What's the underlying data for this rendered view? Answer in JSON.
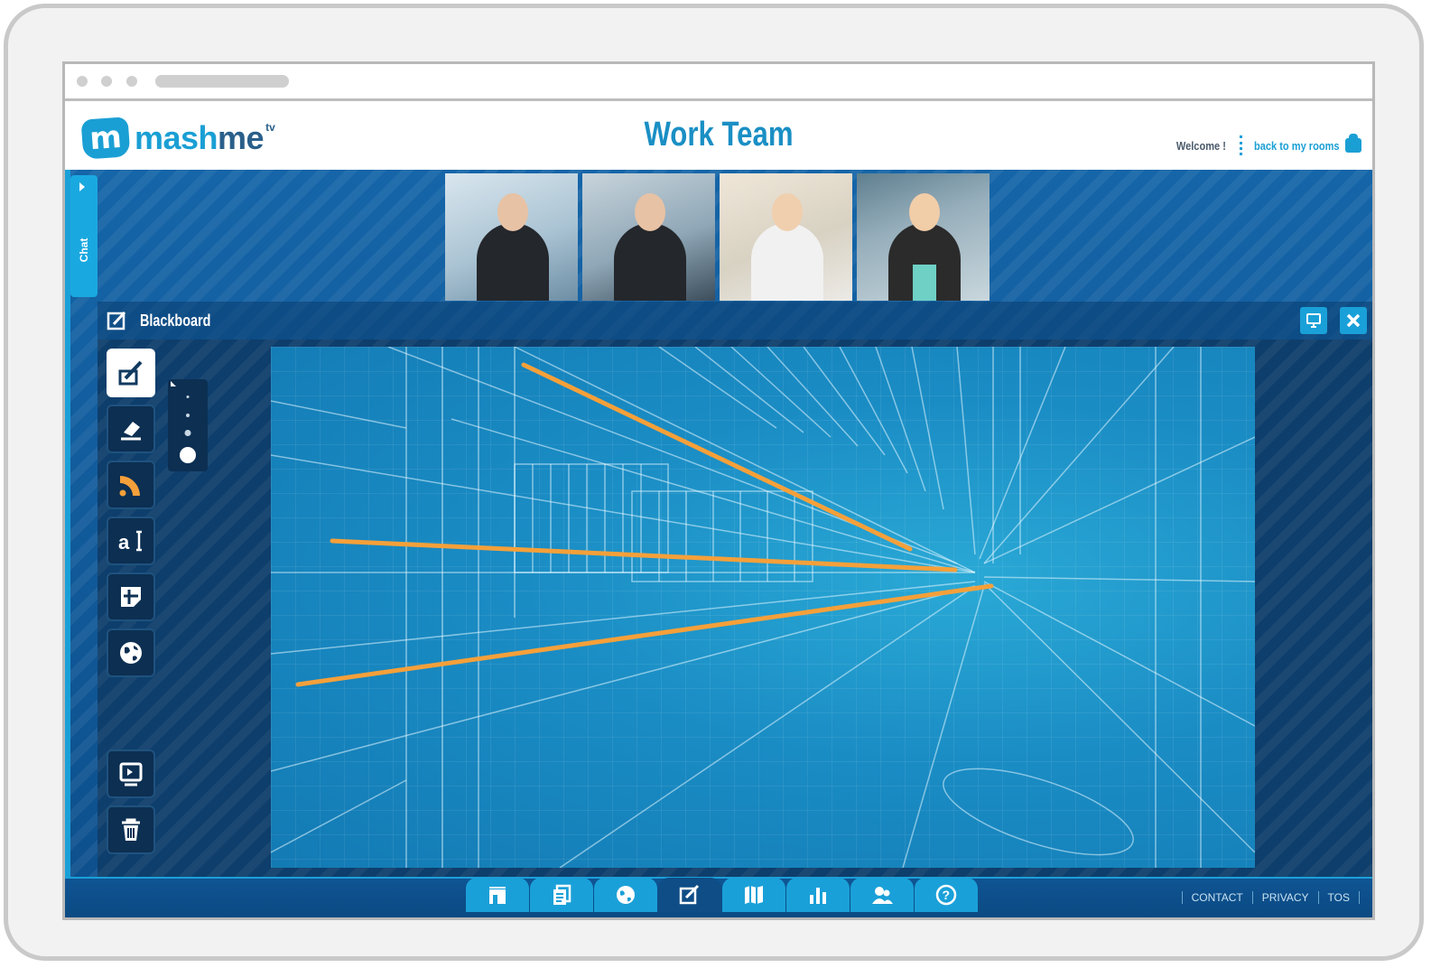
{
  "app": {
    "brand": "mashme",
    "brand_suffix": "tv",
    "room_title": "Work Team",
    "welcome": "Welcome !",
    "back_link": "back to my rooms"
  },
  "chat": {
    "label": "Chat"
  },
  "participants": [
    {
      "name": "participant-1"
    },
    {
      "name": "participant-2"
    },
    {
      "name": "participant-3"
    },
    {
      "name": "participant-4"
    }
  ],
  "blackboard": {
    "title": "Blackboard",
    "tools": [
      "pencil-tool",
      "eraser-tool",
      "line-tool",
      "text-tool",
      "sticky-note-tool",
      "web-tool"
    ],
    "bottom_tools": [
      "save-tool",
      "trash-tool"
    ],
    "active_tool": "pencil-tool",
    "stroke_color": "#f5a03a",
    "brush_sizes": 4,
    "selected_brush_size": 4
  },
  "bottom_nav": {
    "items": [
      "presentation",
      "documents",
      "web",
      "blackboard",
      "maps",
      "charts",
      "contacts",
      "help"
    ],
    "active": "blackboard"
  },
  "footer": {
    "contact": "CONTACT",
    "privacy": "PRIVACY",
    "tos": "TOS"
  },
  "colors": {
    "accent": "#1a9fd4",
    "stage": "#1565a8",
    "canvas": "#1a8cc4",
    "annotation": "#f5a03a"
  }
}
